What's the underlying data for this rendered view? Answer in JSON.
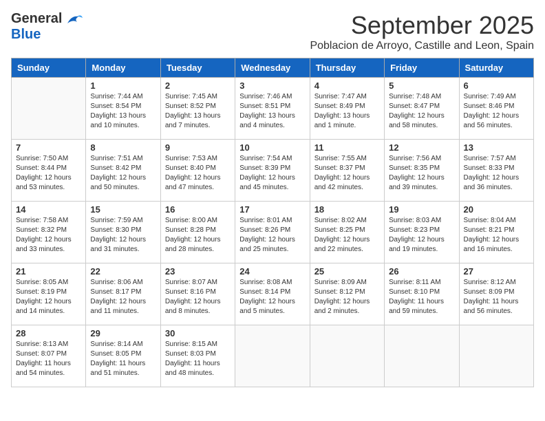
{
  "logo": {
    "general": "General",
    "blue": "Blue"
  },
  "title": "September 2025",
  "subtitle": "Poblacion de Arroyo, Castille and Leon, Spain",
  "days_of_week": [
    "Sunday",
    "Monday",
    "Tuesday",
    "Wednesday",
    "Thursday",
    "Friday",
    "Saturday"
  ],
  "weeks": [
    [
      {
        "day": "",
        "sunrise": "",
        "sunset": "",
        "daylight": ""
      },
      {
        "day": "1",
        "sunrise": "Sunrise: 7:44 AM",
        "sunset": "Sunset: 8:54 PM",
        "daylight": "Daylight: 13 hours and 10 minutes."
      },
      {
        "day": "2",
        "sunrise": "Sunrise: 7:45 AM",
        "sunset": "Sunset: 8:52 PM",
        "daylight": "Daylight: 13 hours and 7 minutes."
      },
      {
        "day": "3",
        "sunrise": "Sunrise: 7:46 AM",
        "sunset": "Sunset: 8:51 PM",
        "daylight": "Daylight: 13 hours and 4 minutes."
      },
      {
        "day": "4",
        "sunrise": "Sunrise: 7:47 AM",
        "sunset": "Sunset: 8:49 PM",
        "daylight": "Daylight: 13 hours and 1 minute."
      },
      {
        "day": "5",
        "sunrise": "Sunrise: 7:48 AM",
        "sunset": "Sunset: 8:47 PM",
        "daylight": "Daylight: 12 hours and 58 minutes."
      },
      {
        "day": "6",
        "sunrise": "Sunrise: 7:49 AM",
        "sunset": "Sunset: 8:46 PM",
        "daylight": "Daylight: 12 hours and 56 minutes."
      }
    ],
    [
      {
        "day": "7",
        "sunrise": "Sunrise: 7:50 AM",
        "sunset": "Sunset: 8:44 PM",
        "daylight": "Daylight: 12 hours and 53 minutes."
      },
      {
        "day": "8",
        "sunrise": "Sunrise: 7:51 AM",
        "sunset": "Sunset: 8:42 PM",
        "daylight": "Daylight: 12 hours and 50 minutes."
      },
      {
        "day": "9",
        "sunrise": "Sunrise: 7:53 AM",
        "sunset": "Sunset: 8:40 PM",
        "daylight": "Daylight: 12 hours and 47 minutes."
      },
      {
        "day": "10",
        "sunrise": "Sunrise: 7:54 AM",
        "sunset": "Sunset: 8:39 PM",
        "daylight": "Daylight: 12 hours and 45 minutes."
      },
      {
        "day": "11",
        "sunrise": "Sunrise: 7:55 AM",
        "sunset": "Sunset: 8:37 PM",
        "daylight": "Daylight: 12 hours and 42 minutes."
      },
      {
        "day": "12",
        "sunrise": "Sunrise: 7:56 AM",
        "sunset": "Sunset: 8:35 PM",
        "daylight": "Daylight: 12 hours and 39 minutes."
      },
      {
        "day": "13",
        "sunrise": "Sunrise: 7:57 AM",
        "sunset": "Sunset: 8:33 PM",
        "daylight": "Daylight: 12 hours and 36 minutes."
      }
    ],
    [
      {
        "day": "14",
        "sunrise": "Sunrise: 7:58 AM",
        "sunset": "Sunset: 8:32 PM",
        "daylight": "Daylight: 12 hours and 33 minutes."
      },
      {
        "day": "15",
        "sunrise": "Sunrise: 7:59 AM",
        "sunset": "Sunset: 8:30 PM",
        "daylight": "Daylight: 12 hours and 31 minutes."
      },
      {
        "day": "16",
        "sunrise": "Sunrise: 8:00 AM",
        "sunset": "Sunset: 8:28 PM",
        "daylight": "Daylight: 12 hours and 28 minutes."
      },
      {
        "day": "17",
        "sunrise": "Sunrise: 8:01 AM",
        "sunset": "Sunset: 8:26 PM",
        "daylight": "Daylight: 12 hours and 25 minutes."
      },
      {
        "day": "18",
        "sunrise": "Sunrise: 8:02 AM",
        "sunset": "Sunset: 8:25 PM",
        "daylight": "Daylight: 12 hours and 22 minutes."
      },
      {
        "day": "19",
        "sunrise": "Sunrise: 8:03 AM",
        "sunset": "Sunset: 8:23 PM",
        "daylight": "Daylight: 12 hours and 19 minutes."
      },
      {
        "day": "20",
        "sunrise": "Sunrise: 8:04 AM",
        "sunset": "Sunset: 8:21 PM",
        "daylight": "Daylight: 12 hours and 16 minutes."
      }
    ],
    [
      {
        "day": "21",
        "sunrise": "Sunrise: 8:05 AM",
        "sunset": "Sunset: 8:19 PM",
        "daylight": "Daylight: 12 hours and 14 minutes."
      },
      {
        "day": "22",
        "sunrise": "Sunrise: 8:06 AM",
        "sunset": "Sunset: 8:17 PM",
        "daylight": "Daylight: 12 hours and 11 minutes."
      },
      {
        "day": "23",
        "sunrise": "Sunrise: 8:07 AM",
        "sunset": "Sunset: 8:16 PM",
        "daylight": "Daylight: 12 hours and 8 minutes."
      },
      {
        "day": "24",
        "sunrise": "Sunrise: 8:08 AM",
        "sunset": "Sunset: 8:14 PM",
        "daylight": "Daylight: 12 hours and 5 minutes."
      },
      {
        "day": "25",
        "sunrise": "Sunrise: 8:09 AM",
        "sunset": "Sunset: 8:12 PM",
        "daylight": "Daylight: 12 hours and 2 minutes."
      },
      {
        "day": "26",
        "sunrise": "Sunrise: 8:11 AM",
        "sunset": "Sunset: 8:10 PM",
        "daylight": "Daylight: 11 hours and 59 minutes."
      },
      {
        "day": "27",
        "sunrise": "Sunrise: 8:12 AM",
        "sunset": "Sunset: 8:09 PM",
        "daylight": "Daylight: 11 hours and 56 minutes."
      }
    ],
    [
      {
        "day": "28",
        "sunrise": "Sunrise: 8:13 AM",
        "sunset": "Sunset: 8:07 PM",
        "daylight": "Daylight: 11 hours and 54 minutes."
      },
      {
        "day": "29",
        "sunrise": "Sunrise: 8:14 AM",
        "sunset": "Sunset: 8:05 PM",
        "daylight": "Daylight: 11 hours and 51 minutes."
      },
      {
        "day": "30",
        "sunrise": "Sunrise: 8:15 AM",
        "sunset": "Sunset: 8:03 PM",
        "daylight": "Daylight: 11 hours and 48 minutes."
      },
      {
        "day": "",
        "sunrise": "",
        "sunset": "",
        "daylight": ""
      },
      {
        "day": "",
        "sunrise": "",
        "sunset": "",
        "daylight": ""
      },
      {
        "day": "",
        "sunrise": "",
        "sunset": "",
        "daylight": ""
      },
      {
        "day": "",
        "sunrise": "",
        "sunset": "",
        "daylight": ""
      }
    ]
  ]
}
